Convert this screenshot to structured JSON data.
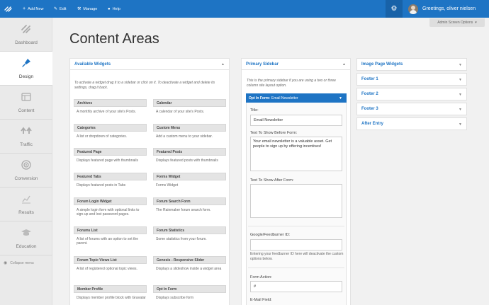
{
  "topbar": {
    "logo_icon": "brand-logo-icon",
    "add_new": "Add New",
    "edit": "Edit",
    "manage": "Manage",
    "help": "Help",
    "greeting": "Greetings, oliver nielsen",
    "bg_color": "#1e74c4"
  },
  "sidebar": {
    "items": [
      {
        "label": "Dashboard",
        "icon": "dashboard-icon"
      },
      {
        "label": "Design",
        "icon": "paintbrush-icon"
      },
      {
        "label": "Content",
        "icon": "content-icon"
      },
      {
        "label": "Traffic",
        "icon": "traffic-arrows-icon"
      },
      {
        "label": "Conversion",
        "icon": "target-icon"
      },
      {
        "label": "Results",
        "icon": "chart-icon"
      },
      {
        "label": "Education",
        "icon": "graduation-cap-icon"
      }
    ],
    "collapse_label": "Collapse menu"
  },
  "screen_options": "Admin Screen Options",
  "page_title": "Content Areas",
  "available_widgets": {
    "title": "Available Widgets",
    "description": "To activate a widget drag it to a sidebar or click on it. To deactivate a widget and delete its settings, drag it back.",
    "widgets": [
      {
        "title": "Archives",
        "desc": "A monthly archive of your site's Posts."
      },
      {
        "title": "Calendar",
        "desc": "A calendar of your site's Posts."
      },
      {
        "title": "Categories",
        "desc": "A list or dropdown of categories."
      },
      {
        "title": "Custom Menu",
        "desc": "Add a custom menu to your sidebar."
      },
      {
        "title": "Featured Page",
        "desc": "Displays featured page with thumbnails"
      },
      {
        "title": "Featured Posts",
        "desc": "Displays featured posts with thumbnails"
      },
      {
        "title": "Featured Tabs",
        "desc": "Displays featured posts in Tabs"
      },
      {
        "title": "Forms Widget",
        "desc": "Forms Widget"
      },
      {
        "title": "Forum Login Widget",
        "desc": "A simple login form with optional links to sign-up and lost password pages."
      },
      {
        "title": "Forum Search Form",
        "desc": "The Rainmaker forum search form."
      },
      {
        "title": "Forums List",
        "desc": "A list of forums with an option to set the parent."
      },
      {
        "title": "Forum Statistics",
        "desc": "Some statistics from your forum."
      },
      {
        "title": "Forum Topic Views List",
        "desc": "A list of registered optional topic views."
      },
      {
        "title": "Genesis - Responsive Slider",
        "desc": "Displays a slideshow inside a widget area"
      },
      {
        "title": "Member Profile",
        "desc": "Displays member profile block with Gravatar"
      },
      {
        "title": "Opt In Form",
        "desc": "Displays subscribe form"
      }
    ]
  },
  "primary_sidebar": {
    "title": "Primary Sidebar",
    "description": "This is the primary sidebar if you are using a two or three column site layout option.",
    "optin": {
      "header_bold": "Opt In Form:",
      "header_name": "Email Newsletter",
      "title_label": "Title:",
      "title_value": "Email Newsletter",
      "before_label": "Text To Show Before Form:",
      "before_value": "Your email newsletter is a valuable asset. Get people to sign up by offering incentives!",
      "after_label": "Text To Show After Form:",
      "after_value": "",
      "feedburner_label": "Google/Feedburner ID:",
      "feedburner_value": "",
      "feedburner_hint": "Entering your feedburner ID here will deactivate the custom options below.",
      "action_label": "Form Action:",
      "action_value": "#",
      "email_label": "E-Mail Field:"
    }
  },
  "right_panels": [
    {
      "title": "Image Page Widgets"
    },
    {
      "title": "Footer 1"
    },
    {
      "title": "Footer 2"
    },
    {
      "title": "Footer 3"
    },
    {
      "title": "After Entry"
    }
  ]
}
